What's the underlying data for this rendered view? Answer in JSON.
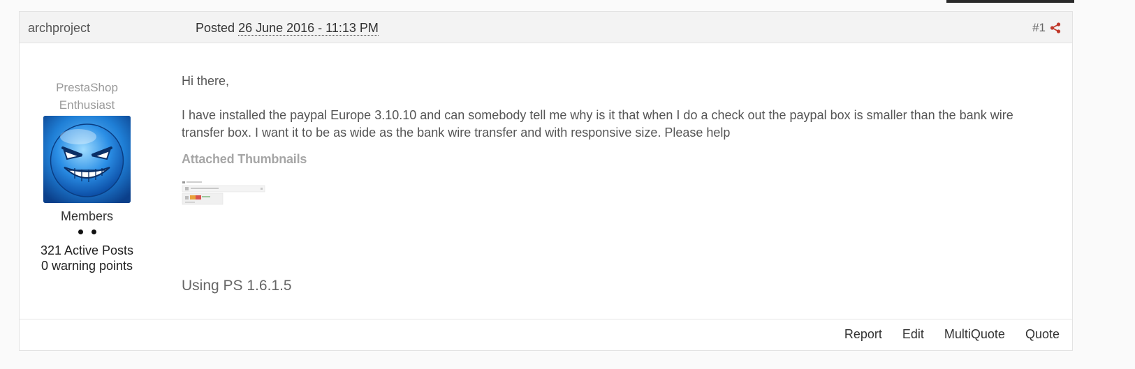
{
  "post": {
    "author": "archproject",
    "posted_prefix": "Posted",
    "posted_date": "26 June 2016 - 11:13 PM",
    "post_number": "#1",
    "share_icon": "share-icon"
  },
  "author_panel": {
    "rank_title": "PrestaShop Enthusiast",
    "group": "Members",
    "pips": 2,
    "active_posts": "321 Active Posts",
    "warning_points": "0 warning points"
  },
  "content": {
    "greeting": "Hi there,",
    "body": "I have installed the paypal Europe 3.10.10 and can somebody tell me why is it that when I do a check out the paypal box is smaller than the bank wire transfer box. I want it to be as wide as the bank wire transfer and with responsive size. Please help",
    "attachments_title": "Attached Thumbnails",
    "signature": "Using PS 1.6.1.5"
  },
  "footer": {
    "actions": [
      "Report",
      "Edit",
      "MultiQuote",
      "Quote"
    ]
  },
  "colors": {
    "header_bg": "#f3f3f3",
    "share_icon": "#c0392b",
    "avatar_blue": "#1e6fb8"
  }
}
